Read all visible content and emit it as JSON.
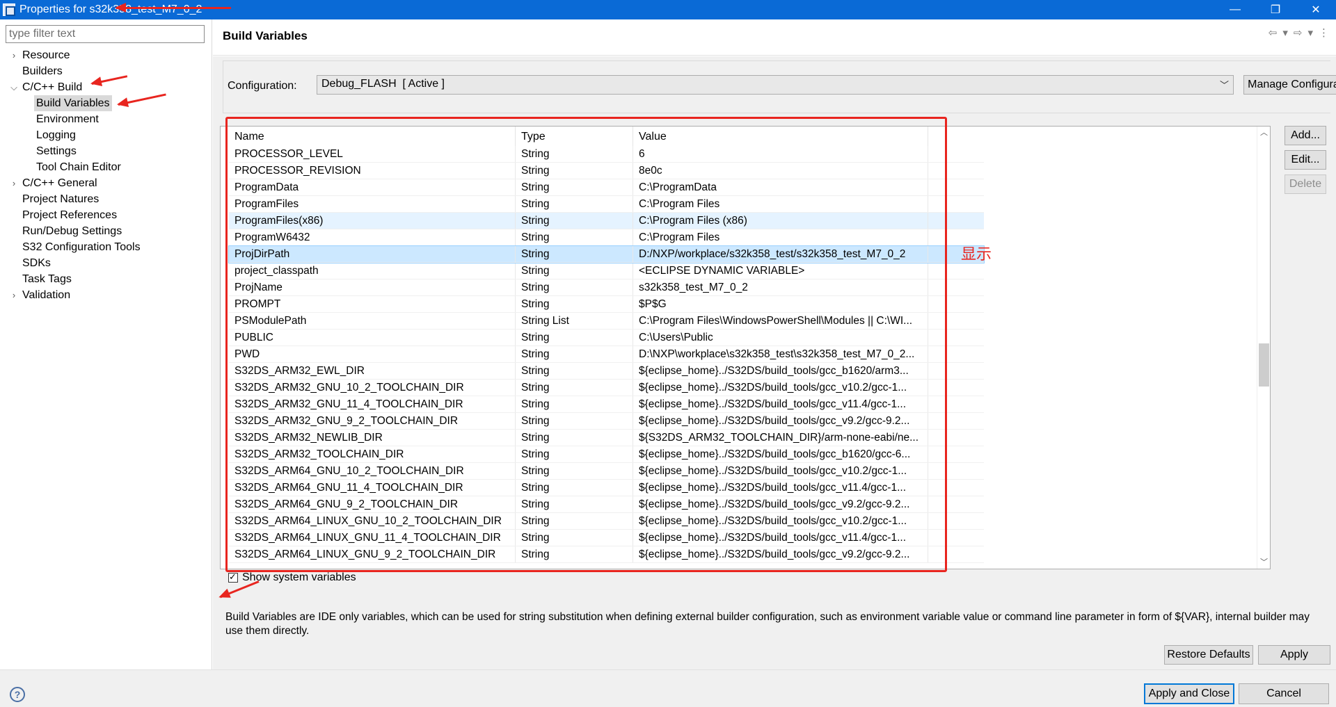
{
  "window": {
    "title": "Properties for s32k358_test_M7_0_2",
    "controls": [
      "—",
      "❐",
      "✕"
    ]
  },
  "sidebar": {
    "filter_placeholder": "type filter text",
    "items": [
      {
        "label": "Resource",
        "expandable": true,
        "expanded": false,
        "level": 0
      },
      {
        "label": "Builders",
        "expandable": false,
        "level": 0
      },
      {
        "label": "C/C++ Build",
        "expandable": true,
        "expanded": true,
        "level": 0
      },
      {
        "label": "Build Variables",
        "expandable": false,
        "level": 1,
        "selected": true
      },
      {
        "label": "Environment",
        "expandable": false,
        "level": 1
      },
      {
        "label": "Logging",
        "expandable": false,
        "level": 1
      },
      {
        "label": "Settings",
        "expandable": false,
        "level": 1
      },
      {
        "label": "Tool Chain Editor",
        "expandable": false,
        "level": 1
      },
      {
        "label": "C/C++ General",
        "expandable": true,
        "expanded": false,
        "level": 0
      },
      {
        "label": "Project Natures",
        "expandable": false,
        "level": 0
      },
      {
        "label": "Project References",
        "expandable": false,
        "level": 0
      },
      {
        "label": "Run/Debug Settings",
        "expandable": false,
        "level": 0
      },
      {
        "label": "S32 Configuration Tools",
        "expandable": false,
        "level": 0
      },
      {
        "label": "SDKs",
        "expandable": false,
        "level": 0
      },
      {
        "label": "Task Tags",
        "expandable": false,
        "level": 0
      },
      {
        "label": "Validation",
        "expandable": true,
        "expanded": false,
        "level": 0
      }
    ]
  },
  "header": {
    "title": "Build Variables",
    "nav_icons": [
      "back-icon",
      "back-dropdown-icon",
      "forward-icon",
      "forward-dropdown-icon",
      "view-menu-icon"
    ]
  },
  "configuration": {
    "label": "Configuration:",
    "value": "Debug_FLASH  [ Active ]",
    "manage_button": "Manage Configurations..."
  },
  "table": {
    "columns": [
      "Name",
      "Type",
      "Value"
    ],
    "rows": [
      [
        "PROCESSOR_LEVEL",
        "String",
        "6"
      ],
      [
        "PROCESSOR_REVISION",
        "String",
        "8e0c"
      ],
      [
        "ProgramData",
        "String",
        "C:\\ProgramData"
      ],
      [
        "ProgramFiles",
        "String",
        "C:\\Program Files"
      ],
      [
        "ProgramFiles(x86)",
        "String",
        "C:\\Program Files (x86)"
      ],
      [
        "ProgramW6432",
        "String",
        "C:\\Program Files"
      ],
      [
        "ProjDirPath",
        "String",
        "D:/NXP/workplace/s32k358_test/s32k358_test_M7_0_2"
      ],
      [
        "project_classpath",
        "String",
        "<ECLIPSE DYNAMIC VARIABLE>"
      ],
      [
        "ProjName",
        "String",
        "s32k358_test_M7_0_2"
      ],
      [
        "PROMPT",
        "String",
        "$P$G"
      ],
      [
        "PSModulePath",
        "String List",
        "C:\\Program Files\\WindowsPowerShell\\Modules || C:\\WI..."
      ],
      [
        "PUBLIC",
        "String",
        "C:\\Users\\Public"
      ],
      [
        "PWD",
        "String",
        "D:\\NXP\\workplace\\s32k358_test\\s32k358_test_M7_0_2..."
      ],
      [
        "S32DS_ARM32_EWL_DIR",
        "String",
        "${eclipse_home}../S32DS/build_tools/gcc_b1620/arm3..."
      ],
      [
        "S32DS_ARM32_GNU_10_2_TOOLCHAIN_DIR",
        "String",
        "${eclipse_home}../S32DS/build_tools/gcc_v10.2/gcc-1..."
      ],
      [
        "S32DS_ARM32_GNU_11_4_TOOLCHAIN_DIR",
        "String",
        "${eclipse_home}../S32DS/build_tools/gcc_v11.4/gcc-1..."
      ],
      [
        "S32DS_ARM32_GNU_9_2_TOOLCHAIN_DIR",
        "String",
        "${eclipse_home}../S32DS/build_tools/gcc_v9.2/gcc-9.2..."
      ],
      [
        "S32DS_ARM32_NEWLIB_DIR",
        "String",
        "${S32DS_ARM32_TOOLCHAIN_DIR}/arm-none-eabi/ne..."
      ],
      [
        "S32DS_ARM32_TOOLCHAIN_DIR",
        "String",
        "${eclipse_home}../S32DS/build_tools/gcc_b1620/gcc-6..."
      ],
      [
        "S32DS_ARM64_GNU_10_2_TOOLCHAIN_DIR",
        "String",
        "${eclipse_home}../S32DS/build_tools/gcc_v10.2/gcc-1..."
      ],
      [
        "S32DS_ARM64_GNU_11_4_TOOLCHAIN_DIR",
        "String",
        "${eclipse_home}../S32DS/build_tools/gcc_v11.4/gcc-1..."
      ],
      [
        "S32DS_ARM64_GNU_9_2_TOOLCHAIN_DIR",
        "String",
        "${eclipse_home}../S32DS/build_tools/gcc_v9.2/gcc-9.2..."
      ],
      [
        "S32DS_ARM64_LINUX_GNU_10_2_TOOLCHAIN_DIR",
        "String",
        "${eclipse_home}../S32DS/build_tools/gcc_v10.2/gcc-1..."
      ],
      [
        "S32DS_ARM64_LINUX_GNU_11_4_TOOLCHAIN_DIR",
        "String",
        "${eclipse_home}../S32DS/build_tools/gcc_v11.4/gcc-1..."
      ],
      [
        "S32DS_ARM64_LINUX_GNU_9_2_TOOLCHAIN_DIR",
        "String",
        "${eclipse_home}../S32DS/build_tools/gcc_v9.2/gcc-9.2..."
      ]
    ],
    "hover_row": 4,
    "selected_row": 6
  },
  "side_buttons": {
    "add": "Add...",
    "edit": "Edit...",
    "delete": "Delete"
  },
  "show_system_variables": {
    "label": "Show system variables",
    "checked": true
  },
  "description": "Build Variables are IDE only variables, which can be used for string substitution when defining external builder configuration, such as environment variable value or command line parameter in form of ${VAR}, internal builder may use them directly.",
  "buttons": {
    "restore_defaults": "Restore Defaults",
    "apply": "Apply",
    "apply_and_close": "Apply and Close",
    "cancel": "Cancel"
  },
  "annotation": {
    "text": "显示",
    "color": "#e8251f"
  },
  "colors": {
    "titlebar": "#0a6ad6",
    "selected_row": "#cce8ff",
    "hover_row": "#e5f3ff",
    "panel_bg": "#f0f0f0"
  }
}
